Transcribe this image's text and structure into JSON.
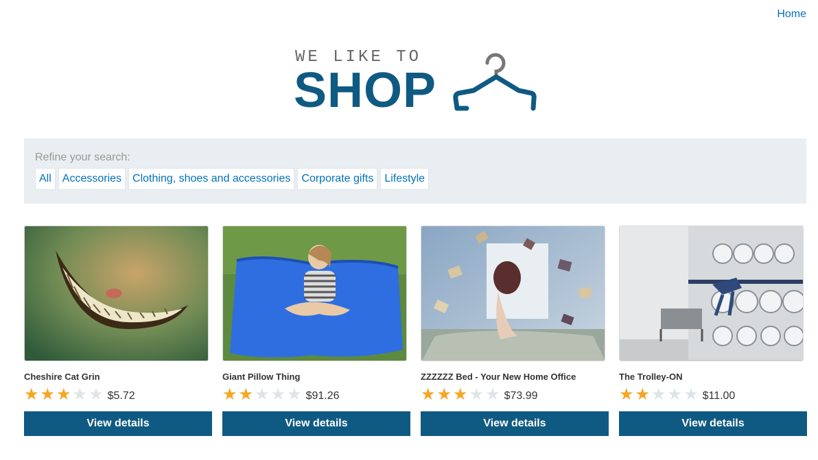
{
  "nav": {
    "home_label": "Home"
  },
  "logo": {
    "tagline": "WE LIKE TO",
    "wordmark": "SHOP",
    "color": "#0f5a82"
  },
  "filters": {
    "label": "Refine your search:",
    "options": [
      "All",
      "Accessories",
      "Clothing, shoes and accessories",
      "Corporate gifts",
      "Lifestyle"
    ]
  },
  "products": [
    {
      "name": "Cheshire Cat Grin",
      "rating": 3,
      "max_rating": 5,
      "price": "$5.72",
      "button": "View details"
    },
    {
      "name": "Giant Pillow Thing",
      "rating": 2,
      "max_rating": 5,
      "price": "$91.26",
      "button": "View details"
    },
    {
      "name": "ZZZZZZ Bed - Your New Home Office",
      "rating": 3,
      "max_rating": 5,
      "price": "$73.99",
      "button": "View details"
    },
    {
      "name": "The Trolley-ON",
      "rating": 2,
      "max_rating": 5,
      "price": "$11.00",
      "button": "View details"
    }
  ],
  "colors": {
    "accent": "#0f5a82",
    "link": "#0071bc",
    "star_on": "#f5a623",
    "star_off": "#dfe4e7",
    "panel_bg": "#e8eef1"
  }
}
